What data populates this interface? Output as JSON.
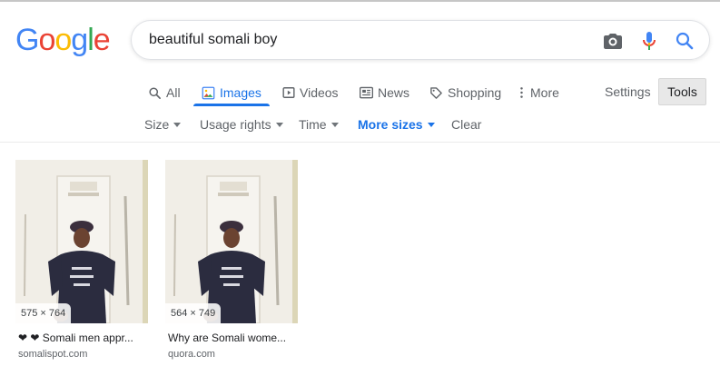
{
  "logo": [
    "G",
    "o",
    "o",
    "g",
    "l",
    "e"
  ],
  "logo_colors": [
    "#4285f4",
    "#ea4335",
    "#fbbc05",
    "#4285f4",
    "#34a853",
    "#ea4335"
  ],
  "search": {
    "query": "beautiful somali boy",
    "camera_icon": "camera-icon",
    "mic_icon": "microphone-icon",
    "search_icon": "search-icon"
  },
  "nav": {
    "items": [
      {
        "label": "All",
        "icon": "search-icon"
      },
      {
        "label": "Images",
        "icon": "images-icon",
        "active": true
      },
      {
        "label": "Videos",
        "icon": "play-icon"
      },
      {
        "label": "News",
        "icon": "newspaper-icon"
      },
      {
        "label": "Shopping",
        "icon": "tag-icon"
      },
      {
        "label": "More",
        "icon": "more-vert-icon"
      }
    ],
    "settings": "Settings",
    "tools": "Tools"
  },
  "filters": [
    {
      "label": "Size",
      "caret": true
    },
    {
      "label": "Usage rights",
      "caret": true
    },
    {
      "label": "Time",
      "caret": true
    },
    {
      "label": "More sizes",
      "caret": true,
      "selected": true
    },
    {
      "label": "Clear",
      "caret": false
    }
  ],
  "results": [
    {
      "dimensions": "575 × 764",
      "title": "❤︎ ❤︎ Somali men appr...",
      "source": "somalispot.com"
    },
    {
      "dimensions": "564 × 749",
      "title": "Why are Somali wome...",
      "source": "quora.com"
    }
  ],
  "colors": {
    "accent": "#1a73e8",
    "text_secondary": "#5f6368"
  }
}
